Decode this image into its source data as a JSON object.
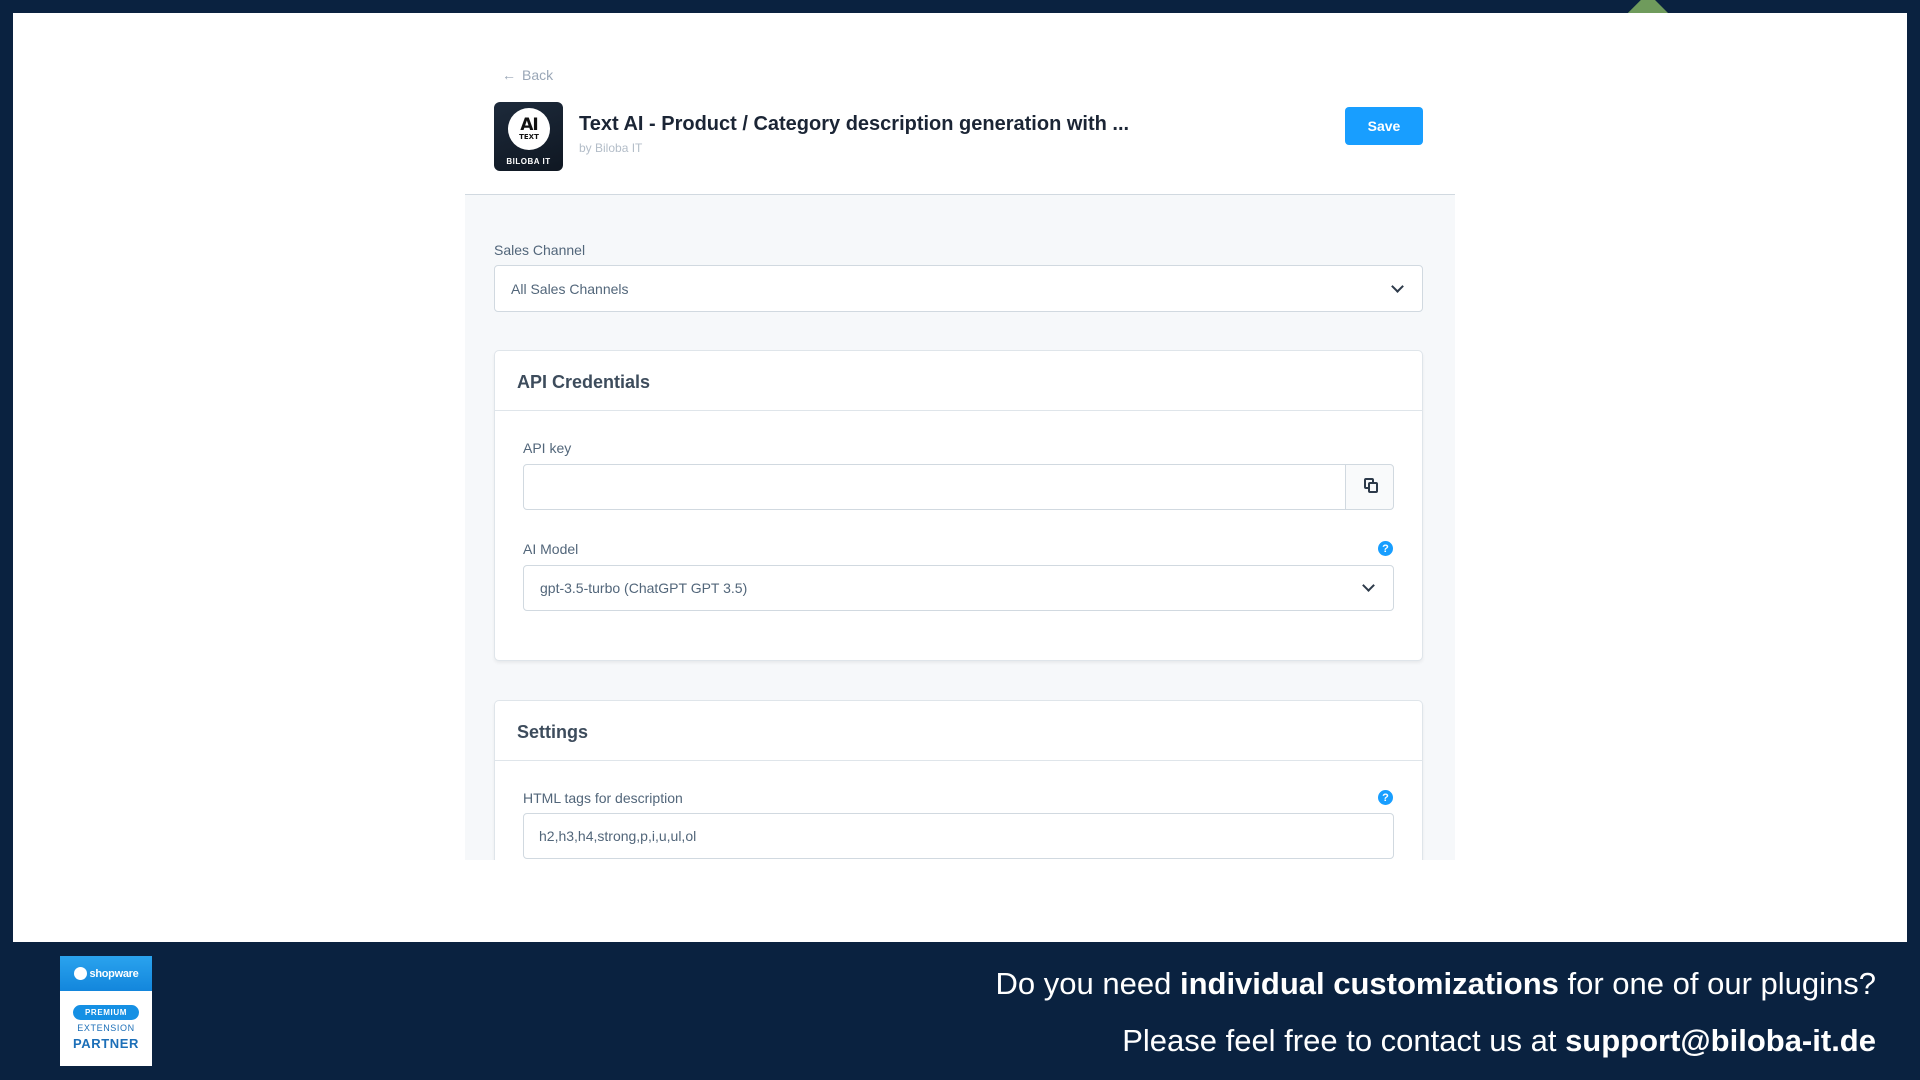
{
  "header": {
    "back_label": "Back",
    "app_title": "Text AI - Product / Category description generation with ...",
    "vendor": "by Biloba IT",
    "save_label": "Save",
    "logo": {
      "line1": "AI",
      "line2": "TEXT",
      "brand": "BILOBA IT"
    }
  },
  "sales_channel": {
    "label": "Sales Channel",
    "value": "All Sales Channels"
  },
  "api_credentials": {
    "title": "API Credentials",
    "api_key_label": "API key",
    "api_key_value": "",
    "ai_model_label": "AI Model",
    "ai_model_value": "gpt-3.5-turbo (ChatGPT GPT 3.5)"
  },
  "settings": {
    "title": "Settings",
    "html_tags_label": "HTML tags for description",
    "html_tags_value": "h2,h3,h4,strong,p,i,u,ul,ol"
  },
  "footer": {
    "line1_pre": "Do you need ",
    "line1_bold": "individual customizations",
    "line1_post": " for one of our plugins?",
    "line2_pre": "Please feel free to contact us at ",
    "line2_bold": "support@biloba-it.de"
  },
  "badge": {
    "brand": "shopware",
    "tier": "PREMIUM",
    "line2": "EXTENSION",
    "line3": "PARTNER"
  },
  "colors": {
    "accent": "#189eff",
    "background_navy": "#0a2240",
    "corner_green": "#6f9b5c"
  }
}
